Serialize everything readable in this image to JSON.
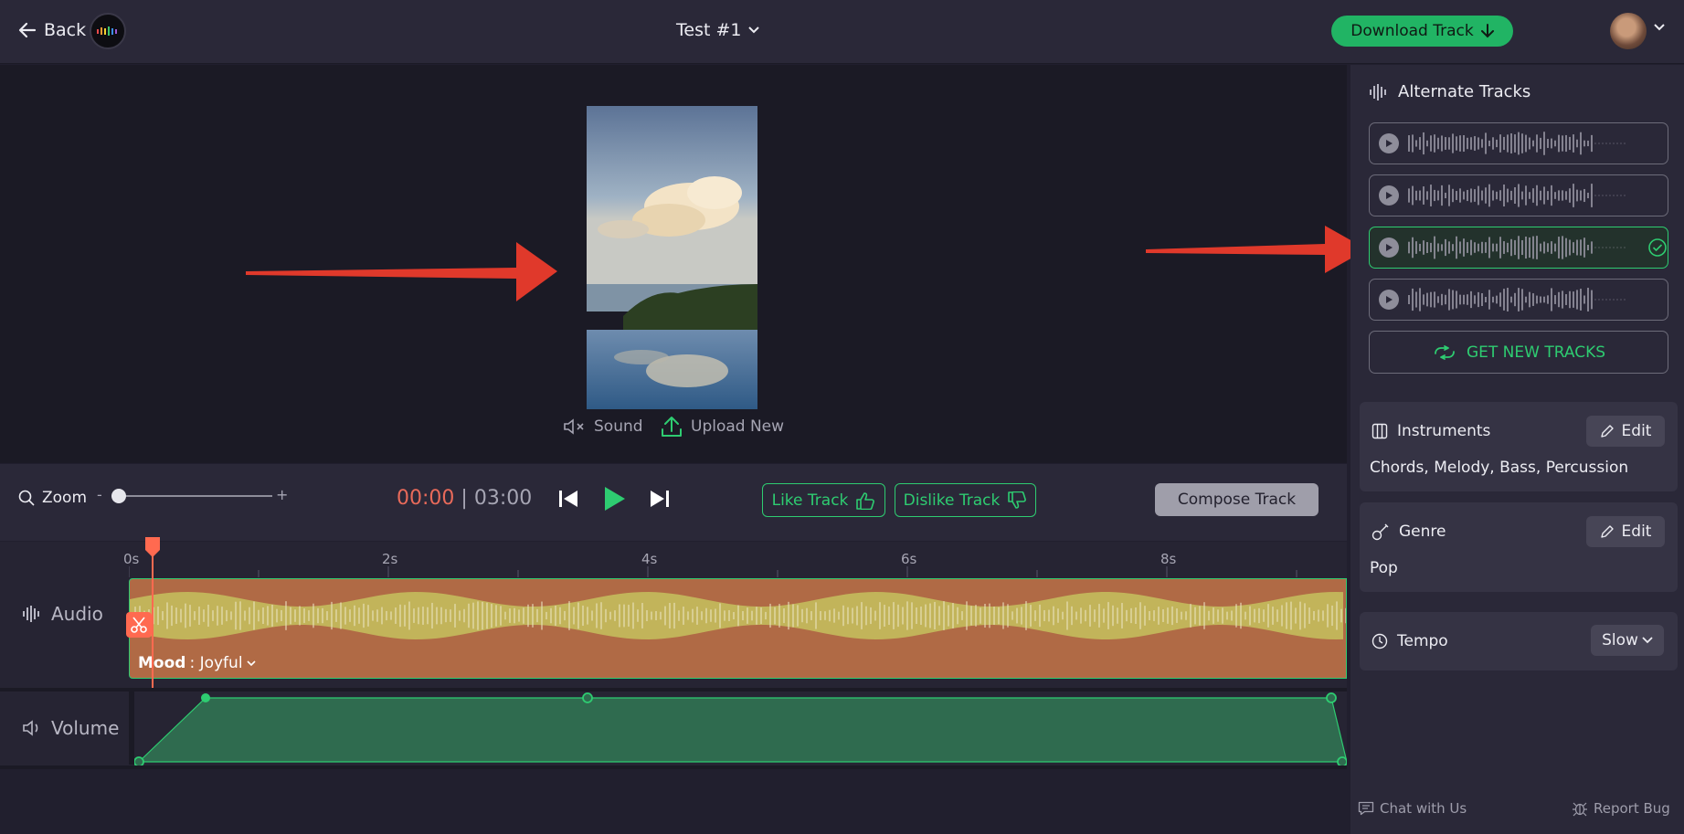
{
  "header": {
    "back_label": "Back",
    "project_title": "Test #1",
    "download_label": "Download Track"
  },
  "video": {
    "sound_label": "Sound",
    "upload_label": "Upload New"
  },
  "controls": {
    "zoom_label": "Zoom",
    "zoom_minus": "-",
    "zoom_plus": "+",
    "zoom_level": 0,
    "time_current": "00:00",
    "time_separator": "|",
    "time_total": "03:00",
    "like_label": "Like Track",
    "dislike_label": "Dislike Track",
    "compose_label": "Compose Track"
  },
  "timeline": {
    "ruler": [
      "0s",
      "2s",
      "4s",
      "6s",
      "8s"
    ],
    "audio_label": "Audio",
    "mood_key": "Mood",
    "mood_value": ": Joyful",
    "volume_label": "Volume"
  },
  "alternate_tracks": {
    "title": "Alternate Tracks",
    "tracks": [
      {
        "selected": false
      },
      {
        "selected": false
      },
      {
        "selected": true
      },
      {
        "selected": false
      }
    ],
    "get_new_label": "GET NEW TRACKS"
  },
  "instruments": {
    "title": "Instruments",
    "edit_label": "Edit",
    "value": "Chords, Melody, Bass, Percussion"
  },
  "genre": {
    "title": "Genre",
    "edit_label": "Edit",
    "value": "Pop"
  },
  "tempo": {
    "title": "Tempo",
    "value": "Slow"
  },
  "footer": {
    "chat_label": "Chat with Us",
    "bug_label": "Report Bug"
  },
  "colors": {
    "accent_green": "#2ecc71",
    "download_green": "#21b464",
    "playhead_red": "#ff6a50",
    "annotation_red": "#e0392b",
    "background": "#211f2e"
  }
}
